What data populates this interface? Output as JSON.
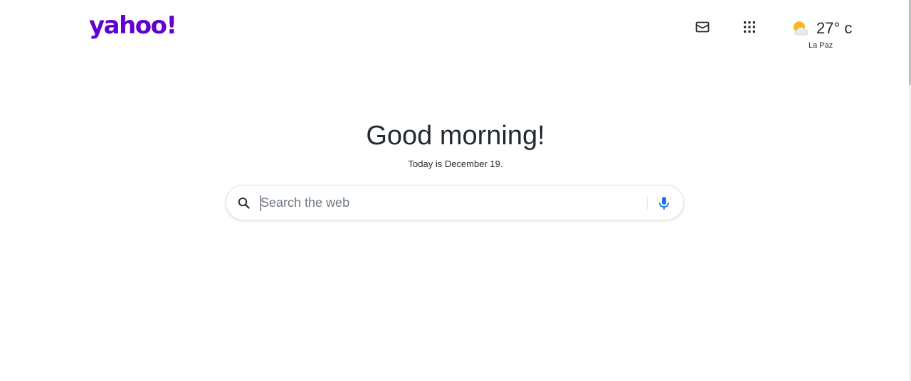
{
  "header": {
    "logo_text": "yahoo!",
    "mail_icon": "mail-icon",
    "apps_icon": "apps-grid-icon",
    "weather": {
      "icon": "partly-cloudy-icon",
      "temperature": "27° c",
      "city": "La Paz"
    }
  },
  "main": {
    "greeting": "Good morning!",
    "date_line": "Today is December 19.",
    "search": {
      "placeholder": "Search the web",
      "value": "",
      "search_icon": "search-icon",
      "mic_icon": "microphone-icon"
    }
  },
  "colors": {
    "brand": "#6001d2",
    "text": "#232a31",
    "mic": "#1a73e8",
    "sun": "#f8b91c"
  }
}
